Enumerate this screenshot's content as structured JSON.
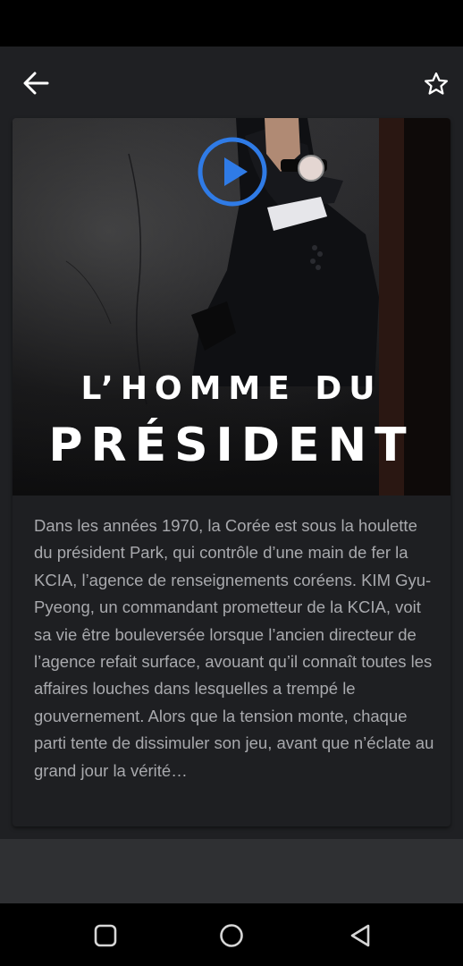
{
  "app_bar": {
    "back_icon": "arrow-left-icon",
    "favorite_icon": "star-outline-icon"
  },
  "poster": {
    "title_line1": "L’HOMME DU",
    "title_line2": "PRÉSIDENT",
    "play_icon": "play-circle-icon",
    "accent_color": "#2f7be6"
  },
  "synopsis": {
    "text": "Dans les années 1970, la Corée est sous la houlette du président Park, qui contrôle d’une main de fer la KCIA, l’agence de renseignements coréens. KIM Gyu-Pyeong, un commandant prometteur de la KCIA, voit sa vie être bouleversée lorsque l’ancien directeur de l’agence refait surface, avouant qu’il connaît toutes les affaires louches dans lesquelles a trempé le gouvernement. Alors que la tension monte, chaque parti tente de dissimuler son jeu, avant que n’éclate au grand jour la vérité…"
  },
  "nav_bar": {
    "recents_icon": "square-icon",
    "home_icon": "circle-icon",
    "back_icon": "triangle-back-icon"
  },
  "colors": {
    "background": "#1f2023",
    "text": "#a8a9ad",
    "accent": "#2f7be6"
  }
}
